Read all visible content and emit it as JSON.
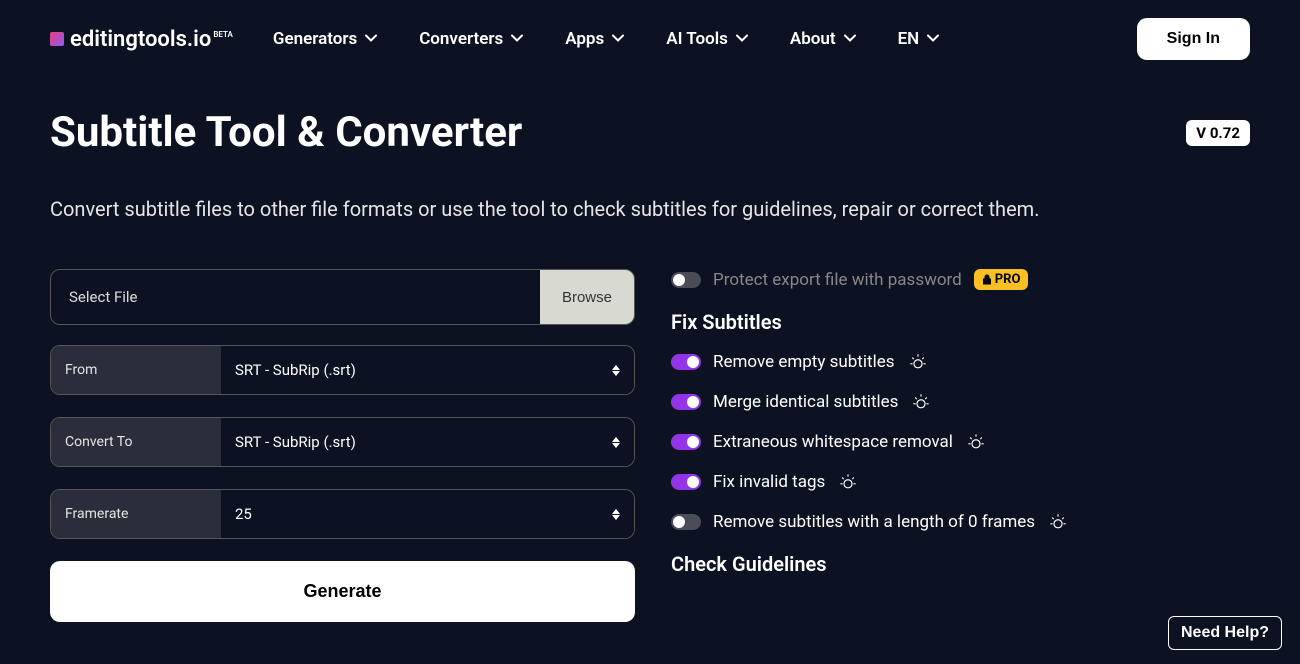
{
  "header": {
    "logo_text": "editingtools.io",
    "logo_beta": "BETA",
    "nav": [
      "Generators",
      "Converters",
      "Apps",
      "AI Tools",
      "About",
      "EN"
    ],
    "signin": "Sign In"
  },
  "page": {
    "title": "Subtitle Tool & Converter",
    "version": "V 0.72",
    "subtitle": "Convert subtitle files to other file formats or use the tool to check subtitles for guidelines, repair or correct them."
  },
  "form": {
    "select_file_label": "Select File",
    "browse": "Browse",
    "from_label": "From",
    "from_value": "SRT - SubRip (.srt)",
    "to_label": "Convert To",
    "to_value": "SRT - SubRip (.srt)",
    "framerate_label": "Framerate",
    "framerate_value": "25",
    "generate": "Generate"
  },
  "options": {
    "protect_label": "Protect export file with password",
    "pro_label": "PRO",
    "fix_heading": "Fix Subtitles",
    "fix": [
      {
        "label": "Remove empty subtitles",
        "on": true
      },
      {
        "label": "Merge identical subtitles",
        "on": true
      },
      {
        "label": "Extraneous whitespace removal",
        "on": true
      },
      {
        "label": "Fix invalid tags",
        "on": true
      },
      {
        "label": "Remove subtitles with a length of 0 frames",
        "on": false
      }
    ],
    "check_heading": "Check Guidelines"
  },
  "help": "Need Help?"
}
